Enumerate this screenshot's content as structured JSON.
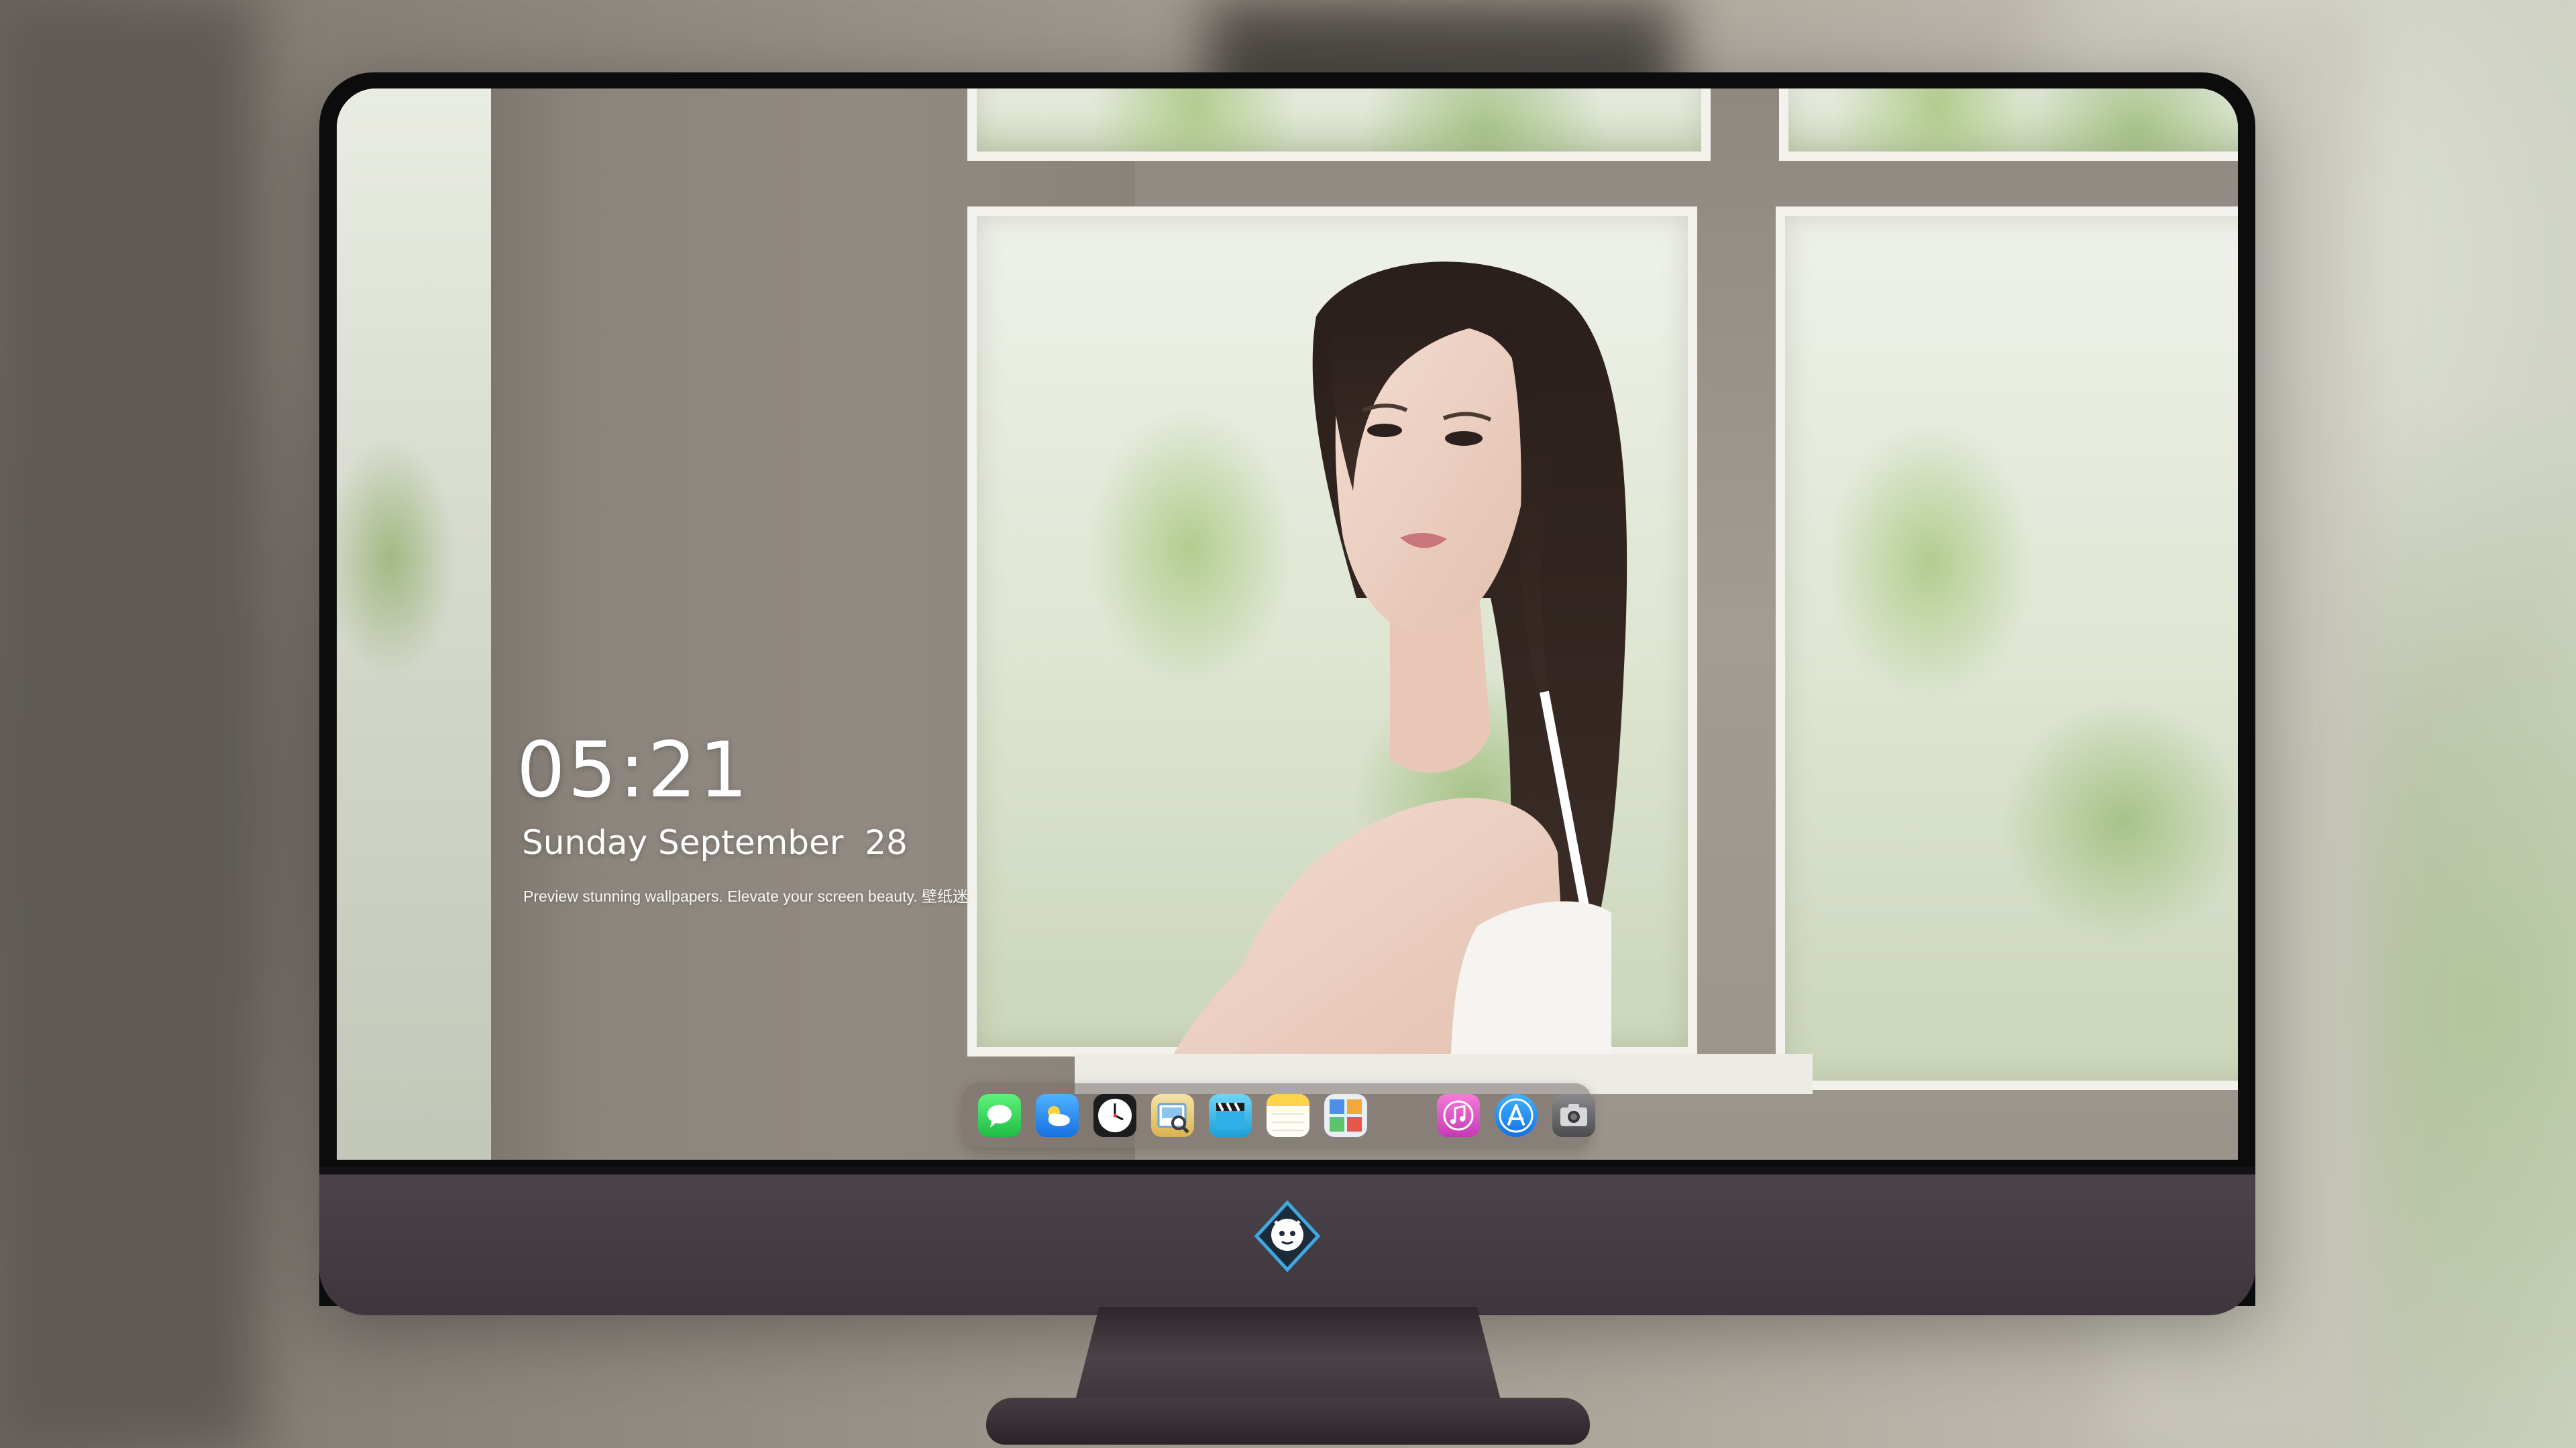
{
  "lockscreen": {
    "time": "05:21",
    "date": "Sunday September  28",
    "tagline": "Preview stunning wallpapers. Elevate your screen beauty. 壁纸迷"
  },
  "dock": {
    "apps": [
      {
        "name": "messages-icon",
        "color": "#2fd158"
      },
      {
        "name": "weather-icon",
        "color": "#2a8cf0"
      },
      {
        "name": "clock-icon",
        "color": "#1c1c1e"
      },
      {
        "name": "preview-icon",
        "color": "#e8c66a"
      },
      {
        "name": "claquette-icon",
        "color": "#36b6e8"
      },
      {
        "name": "notes-icon",
        "color": "#fcd34a"
      },
      {
        "name": "photo-booth-icon",
        "color": "#4b8fe8"
      },
      {
        "name": "itunes-icon",
        "color": "#e94ac8"
      },
      {
        "name": "app-store-icon",
        "color": "#1d8cf8"
      },
      {
        "name": "camera-icon",
        "color": "#5a5a5c"
      }
    ]
  },
  "colors": {
    "monitor_bezel": "#0d0c0d",
    "monitor_chin": "#453d42",
    "clock_text": "#ffffff"
  }
}
